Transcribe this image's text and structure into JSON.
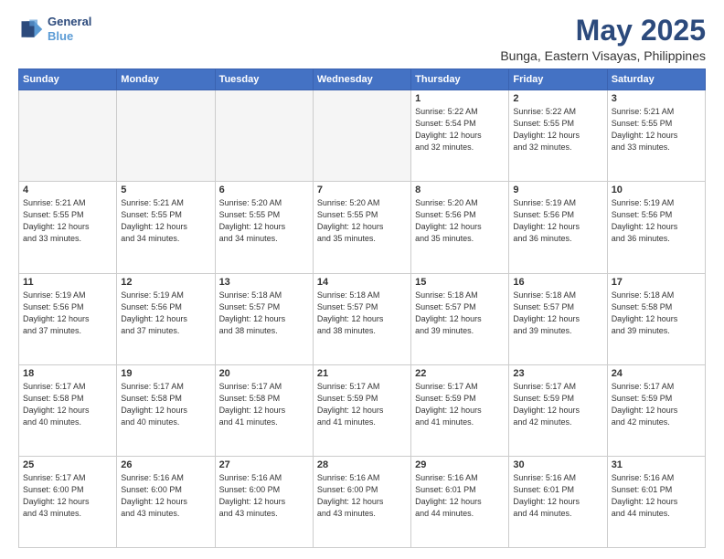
{
  "header": {
    "logo_line1": "General",
    "logo_line2": "Blue",
    "title": "May 2025",
    "subtitle": "Bunga, Eastern Visayas, Philippines"
  },
  "weekdays": [
    "Sunday",
    "Monday",
    "Tuesday",
    "Wednesday",
    "Thursday",
    "Friday",
    "Saturday"
  ],
  "weeks": [
    [
      {
        "day": "",
        "info": ""
      },
      {
        "day": "",
        "info": ""
      },
      {
        "day": "",
        "info": ""
      },
      {
        "day": "",
        "info": ""
      },
      {
        "day": "1",
        "info": "Sunrise: 5:22 AM\nSunset: 5:54 PM\nDaylight: 12 hours\nand 32 minutes."
      },
      {
        "day": "2",
        "info": "Sunrise: 5:22 AM\nSunset: 5:55 PM\nDaylight: 12 hours\nand 32 minutes."
      },
      {
        "day": "3",
        "info": "Sunrise: 5:21 AM\nSunset: 5:55 PM\nDaylight: 12 hours\nand 33 minutes."
      }
    ],
    [
      {
        "day": "4",
        "info": "Sunrise: 5:21 AM\nSunset: 5:55 PM\nDaylight: 12 hours\nand 33 minutes."
      },
      {
        "day": "5",
        "info": "Sunrise: 5:21 AM\nSunset: 5:55 PM\nDaylight: 12 hours\nand 34 minutes."
      },
      {
        "day": "6",
        "info": "Sunrise: 5:20 AM\nSunset: 5:55 PM\nDaylight: 12 hours\nand 34 minutes."
      },
      {
        "day": "7",
        "info": "Sunrise: 5:20 AM\nSunset: 5:55 PM\nDaylight: 12 hours\nand 35 minutes."
      },
      {
        "day": "8",
        "info": "Sunrise: 5:20 AM\nSunset: 5:56 PM\nDaylight: 12 hours\nand 35 minutes."
      },
      {
        "day": "9",
        "info": "Sunrise: 5:19 AM\nSunset: 5:56 PM\nDaylight: 12 hours\nand 36 minutes."
      },
      {
        "day": "10",
        "info": "Sunrise: 5:19 AM\nSunset: 5:56 PM\nDaylight: 12 hours\nand 36 minutes."
      }
    ],
    [
      {
        "day": "11",
        "info": "Sunrise: 5:19 AM\nSunset: 5:56 PM\nDaylight: 12 hours\nand 37 minutes."
      },
      {
        "day": "12",
        "info": "Sunrise: 5:19 AM\nSunset: 5:56 PM\nDaylight: 12 hours\nand 37 minutes."
      },
      {
        "day": "13",
        "info": "Sunrise: 5:18 AM\nSunset: 5:57 PM\nDaylight: 12 hours\nand 38 minutes."
      },
      {
        "day": "14",
        "info": "Sunrise: 5:18 AM\nSunset: 5:57 PM\nDaylight: 12 hours\nand 38 minutes."
      },
      {
        "day": "15",
        "info": "Sunrise: 5:18 AM\nSunset: 5:57 PM\nDaylight: 12 hours\nand 39 minutes."
      },
      {
        "day": "16",
        "info": "Sunrise: 5:18 AM\nSunset: 5:57 PM\nDaylight: 12 hours\nand 39 minutes."
      },
      {
        "day": "17",
        "info": "Sunrise: 5:18 AM\nSunset: 5:58 PM\nDaylight: 12 hours\nand 39 minutes."
      }
    ],
    [
      {
        "day": "18",
        "info": "Sunrise: 5:17 AM\nSunset: 5:58 PM\nDaylight: 12 hours\nand 40 minutes."
      },
      {
        "day": "19",
        "info": "Sunrise: 5:17 AM\nSunset: 5:58 PM\nDaylight: 12 hours\nand 40 minutes."
      },
      {
        "day": "20",
        "info": "Sunrise: 5:17 AM\nSunset: 5:58 PM\nDaylight: 12 hours\nand 41 minutes."
      },
      {
        "day": "21",
        "info": "Sunrise: 5:17 AM\nSunset: 5:59 PM\nDaylight: 12 hours\nand 41 minutes."
      },
      {
        "day": "22",
        "info": "Sunrise: 5:17 AM\nSunset: 5:59 PM\nDaylight: 12 hours\nand 41 minutes."
      },
      {
        "day": "23",
        "info": "Sunrise: 5:17 AM\nSunset: 5:59 PM\nDaylight: 12 hours\nand 42 minutes."
      },
      {
        "day": "24",
        "info": "Sunrise: 5:17 AM\nSunset: 5:59 PM\nDaylight: 12 hours\nand 42 minutes."
      }
    ],
    [
      {
        "day": "25",
        "info": "Sunrise: 5:17 AM\nSunset: 6:00 PM\nDaylight: 12 hours\nand 43 minutes."
      },
      {
        "day": "26",
        "info": "Sunrise: 5:16 AM\nSunset: 6:00 PM\nDaylight: 12 hours\nand 43 minutes."
      },
      {
        "day": "27",
        "info": "Sunrise: 5:16 AM\nSunset: 6:00 PM\nDaylight: 12 hours\nand 43 minutes."
      },
      {
        "day": "28",
        "info": "Sunrise: 5:16 AM\nSunset: 6:00 PM\nDaylight: 12 hours\nand 43 minutes."
      },
      {
        "day": "29",
        "info": "Sunrise: 5:16 AM\nSunset: 6:01 PM\nDaylight: 12 hours\nand 44 minutes."
      },
      {
        "day": "30",
        "info": "Sunrise: 5:16 AM\nSunset: 6:01 PM\nDaylight: 12 hours\nand 44 minutes."
      },
      {
        "day": "31",
        "info": "Sunrise: 5:16 AM\nSunset: 6:01 PM\nDaylight: 12 hours\nand 44 minutes."
      }
    ]
  ]
}
